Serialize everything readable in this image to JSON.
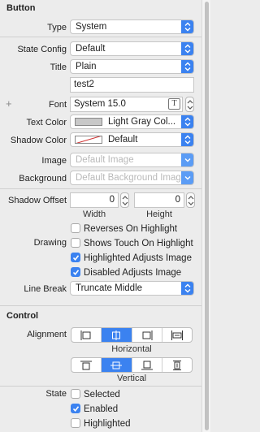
{
  "button_section": {
    "title": "Button",
    "type": {
      "label": "Type",
      "value": "System"
    },
    "state_config": {
      "label": "State Config",
      "value": "Default"
    },
    "title_row": {
      "label": "Title",
      "value": "Plain"
    },
    "title_text": "test2",
    "font": {
      "label": "Font",
      "value": "System 15.0"
    },
    "text_color": {
      "label": "Text Color",
      "value": "Light Gray Col...",
      "swatch": "#c8c8c8"
    },
    "shadow_color": {
      "label": "Shadow Color",
      "value": "Default"
    },
    "image": {
      "label": "Image",
      "placeholder": "Default Image"
    },
    "background": {
      "label": "Background",
      "placeholder": "Default Background Imag"
    },
    "shadow_offset": {
      "label": "Shadow Offset",
      "width": "0",
      "height": "0",
      "width_label": "Width",
      "height_label": "Height"
    },
    "drawing": {
      "label": "Drawing",
      "reverses": "Reverses On Highlight",
      "shows_touch": "Shows Touch On Highlight",
      "highlighted_adjusts": "Highlighted Adjusts Image",
      "disabled_adjusts": "Disabled Adjusts Image"
    },
    "line_break": {
      "label": "Line Break",
      "value": "Truncate Middle"
    }
  },
  "control_section": {
    "title": "Control",
    "alignment_label": "Alignment",
    "horizontal_label": "Horizontal",
    "vertical_label": "Vertical",
    "state_label": "State",
    "selected": "Selected",
    "enabled": "Enabled",
    "highlighted": "Highlighted"
  },
  "checkbox_state": {
    "reverses": false,
    "shows_touch": false,
    "highlighted_adjusts": true,
    "disabled_adjusts": true,
    "selected": false,
    "enabled": true,
    "highlighted": false
  },
  "colors": {
    "accent": "#3b82f0",
    "panel": "#ececec"
  }
}
